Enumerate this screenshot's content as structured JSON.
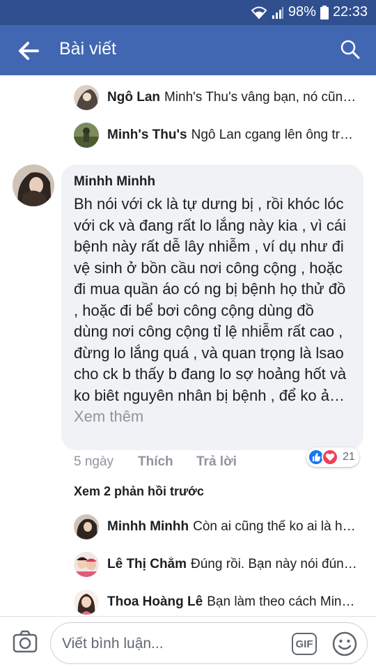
{
  "status_bar": {
    "battery": "98%",
    "time": "22:33"
  },
  "header": {
    "title": "Bài viết"
  },
  "replies_top": [
    {
      "name": "Ngô Lan",
      "text": "Minh's Thu's vâng bạn, nó cũng ngứa..."
    },
    {
      "name": "Minh's Thu's",
      "text": "Ngô Lan cgang lên ông trời cho nhé..."
    }
  ],
  "comment": {
    "author": "Minhh Minhh",
    "body": "Bh nói với ck là tự dưng bị , rồi khóc lóc với ck và đang rất lo lắng này kia , vì cái bệnh này rất dễ lây nhiễm , ví dụ như đi vệ sinh ở bồn cầu nơi công cộng , hoặc đi mua quần áo có ng bị bệnh họ thử đồ , hoặc đi bể bơi công cộng dùng đồ dùng nơi công cộng tỉ lệ nhiễm rất cao , đừng lo lắng quá , và quan trọng là lsao cho ck b thấy b đang lo sợ hoảng hốt và ko biêt nguyên nhân bị bệnh , để ko ả…",
    "see_more": "Xem thêm",
    "age": "5 ngày",
    "like_label": "Thích",
    "reply_label": "Trả lời",
    "reaction_count": "21"
  },
  "view_previous": "Xem 2 phản hồi trước",
  "replies_bottom": [
    {
      "name": "Minhh Minhh",
      "text": "Còn ai cũng thế ko ai là hoàn hảo..."
    },
    {
      "name": "Lê Thị Chắm",
      "text": "Đúng rồi. Bạn này nói đúng đó..."
    },
    {
      "name": "Thoa Hoàng Lê",
      "text": "Bạn làm theo cách Minhh Minhh..."
    }
  ],
  "composer": {
    "placeholder": "Viết bình luận...",
    "gif_label": "GIF"
  },
  "colors": {
    "header": "#4267b2",
    "status": "#2f4f8f",
    "like_blue": "#1877f2",
    "love_red": "#f33e58"
  }
}
